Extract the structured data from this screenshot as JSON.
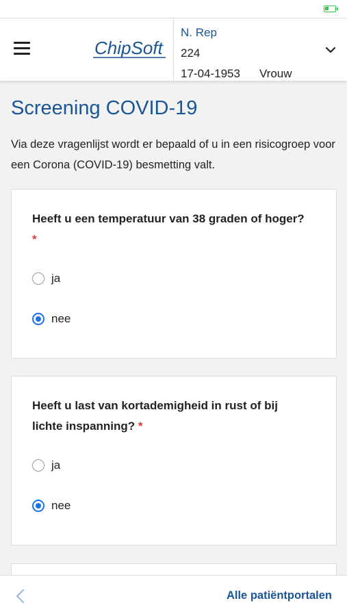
{
  "colors": {
    "brand": "#1a5596",
    "radio_selected": "#1a73e8",
    "required": "#e53935",
    "battery": "#2ecc40"
  },
  "header": {
    "logo_text": "ChipSoft",
    "patient": {
      "name": "N. Rep",
      "id": "224",
      "birthdate": "17-04-1953",
      "gender": "Vrouw"
    }
  },
  "main": {
    "title": "Screening COVID-19",
    "intro": "Via deze vragenlijst wordt er bepaald of u in een risicogroep voor een Corona (COVID-19) besmetting valt.",
    "questions": [
      {
        "text": "Heeft u een temperatuur van 38 graden of hoger?",
        "required_mark": "*",
        "options": [
          "ja",
          "nee"
        ],
        "selected": "nee"
      },
      {
        "text": "Heeft u last van kortademigheid in rust of bij lichte inspanning?",
        "required_mark": "*",
        "options": [
          "ja",
          "nee"
        ],
        "selected": "nee"
      }
    ]
  },
  "footer": {
    "back_icon": "chevron-left-icon",
    "portals_label": "Alle patiëntportalen"
  }
}
